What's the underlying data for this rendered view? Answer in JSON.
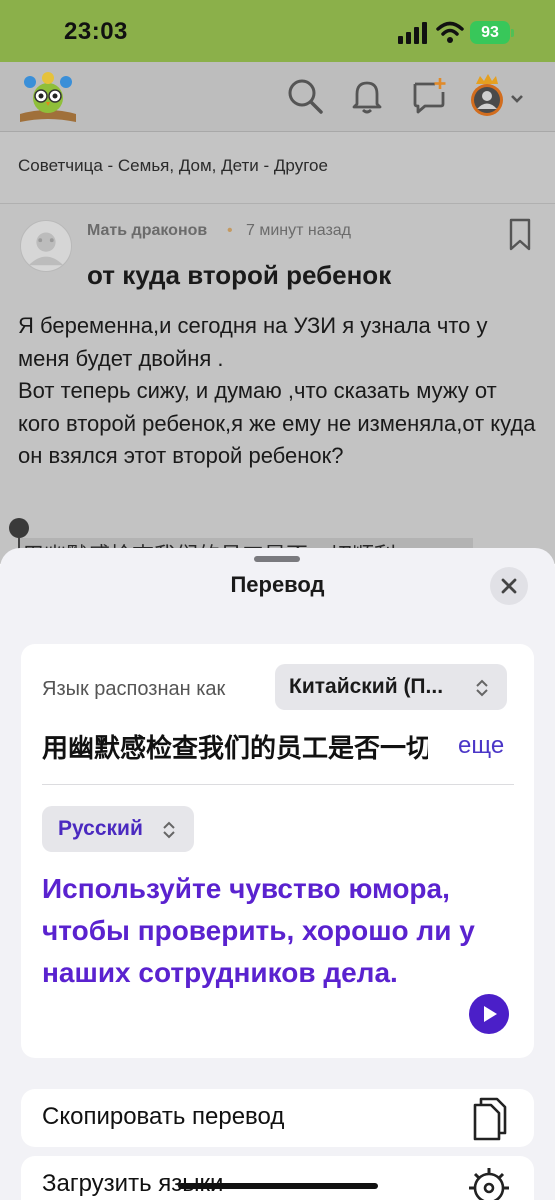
{
  "status_bar": {
    "time": "23:03",
    "battery": "93"
  },
  "header": {
    "logo": "owl-logo-icon",
    "icons": [
      "search-icon",
      "bell-icon",
      "new-message-icon",
      "avatar-icon",
      "chevron-down-icon"
    ]
  },
  "breadcrumb": "Советчица - Семья, Дом, Дети - Другое",
  "post": {
    "author": "Мать драконов",
    "separator": "•",
    "time_ago": "7 минут назад",
    "title": "от куда второй ребенок",
    "body": "Я беременна,и сегодня на УЗИ я узнала что у меня будет двойня .\nВот теперь сижу, и думаю ,что сказать мужу от кого второй ребенок,я же ему не изменяла,от куда он взялся этот второй ребенок?",
    "selected_snippet": "用幽默感检查我们的员工是否一切顺利"
  },
  "sheet": {
    "title": "Перевод",
    "detected_label": "Язык распознан как",
    "source_language": "Китайский (П...",
    "source_text": "用幽默感检查我们的员工是否一切顺利",
    "more_label": "еще",
    "target_language": "Русский",
    "translation": "Используйте чувство юмора, чтобы проверить, хорошо ли у наших сотрудников дела.",
    "actions": {
      "copy": "Скопировать перевод",
      "download": "Загрузить языки"
    }
  },
  "colors": {
    "status_bar": "#8bb04a",
    "accent_purple": "#5a22cf",
    "link_purple": "#4b36c7",
    "battery_green": "#38c75a"
  }
}
